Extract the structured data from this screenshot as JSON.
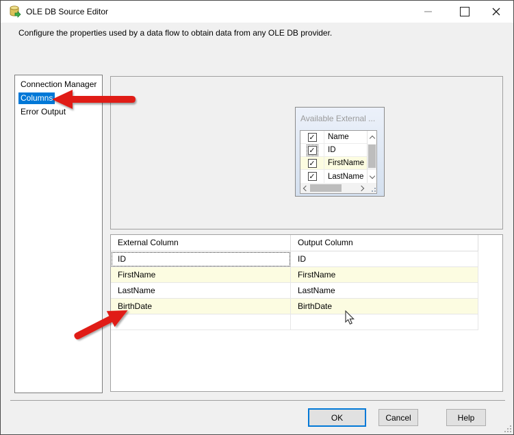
{
  "window": {
    "title": "OLE DB Source Editor",
    "description": "Configure the properties used by a data flow to obtain data from any OLE DB provider."
  },
  "nav": {
    "items": [
      {
        "label": "Connection Manager",
        "selected": false
      },
      {
        "label": "Columns",
        "selected": true
      },
      {
        "label": "Error Output",
        "selected": false
      }
    ]
  },
  "available_external": {
    "title": "Available External ...",
    "header": "Name",
    "check_glyph": "✓",
    "rows": [
      {
        "label": "ID",
        "checked": true,
        "highlighted": false,
        "focused": true
      },
      {
        "label": "FirstName",
        "checked": true,
        "highlighted": true,
        "focused": false
      },
      {
        "label": "LastName",
        "checked": true,
        "highlighted": false,
        "focused": false
      }
    ]
  },
  "mapping_table": {
    "columns": [
      "External Column",
      "Output Column"
    ],
    "rows": [
      {
        "external": "ID",
        "output": "ID",
        "highlighted": false,
        "focused": true
      },
      {
        "external": "FirstName",
        "output": "FirstName",
        "highlighted": true,
        "focused": false
      },
      {
        "external": "LastName",
        "output": "LastName",
        "highlighted": false,
        "focused": false
      },
      {
        "external": "BirthDate",
        "output": "BirthDate",
        "highlighted": true,
        "focused": false
      },
      {
        "external": "",
        "output": "",
        "highlighted": false,
        "focused": false
      }
    ]
  },
  "buttons": {
    "ok": "OK",
    "cancel": "Cancel",
    "help": "Help"
  },
  "colors": {
    "accent": "#0078d7",
    "row_highlight": "#fcfce1",
    "annotation_arrow": "#e01b14"
  }
}
